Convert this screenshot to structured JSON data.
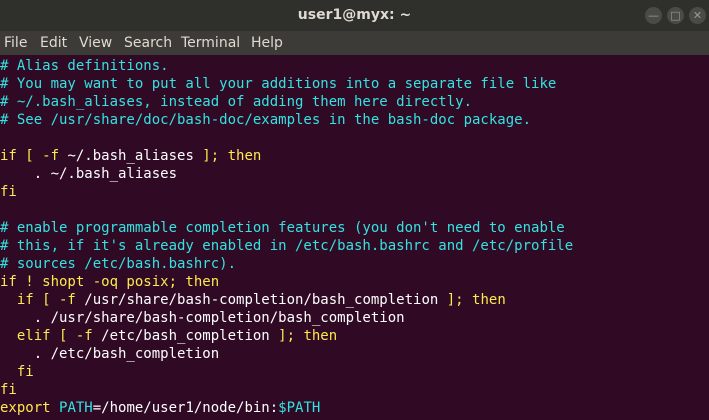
{
  "window": {
    "title": "user1@myx: ~",
    "minimize": "—",
    "maximize": "□",
    "close": "✕"
  },
  "menu": [
    "File",
    "Edit",
    "View",
    "Search",
    "Terminal",
    "Help"
  ],
  "colors": {
    "background": "#300a24",
    "comment": "#34e2e2",
    "keyword": "#fce94f",
    "text": "#ffffff"
  },
  "lines": [
    [
      {
        "t": "# Alias definitions.",
        "c": "c"
      }
    ],
    [
      {
        "t": "# You may want to put all your additions into a separate file like",
        "c": "c"
      }
    ],
    [
      {
        "t": "# ~/.bash_aliases, instead of adding them here directly.",
        "c": "c"
      }
    ],
    [
      {
        "t": "# See /usr/share/doc/bash-doc/examples in the bash-doc package.",
        "c": "c"
      }
    ],
    [],
    [
      {
        "t": "if [ -f ",
        "c": "k"
      },
      {
        "t": "~/.bash_aliases",
        "c": ""
      },
      {
        "t": " ]; then",
        "c": "k"
      }
    ],
    [
      {
        "t": "    . ~/.bash_aliases",
        "c": ""
      }
    ],
    [
      {
        "t": "fi",
        "c": "k"
      }
    ],
    [],
    [
      {
        "t": "# enable programmable completion features (you don't need to enable",
        "c": "c"
      }
    ],
    [
      {
        "t": "# this, if it's already enabled in /etc/bash.bashrc and /etc/profile",
        "c": "c"
      }
    ],
    [
      {
        "t": "# sources /etc/bash.bashrc).",
        "c": "c"
      }
    ],
    [
      {
        "t": "if ! shopt -oq posix; then",
        "c": "k"
      }
    ],
    [
      {
        "t": "  if [ -f ",
        "c": "k"
      },
      {
        "t": "/usr/share/bash-completion/bash_completion",
        "c": ""
      },
      {
        "t": " ]; then",
        "c": "k"
      }
    ],
    [
      {
        "t": "    . /usr/share/bash-completion/bash_completion",
        "c": ""
      }
    ],
    [
      {
        "t": "  elif [ -f ",
        "c": "k"
      },
      {
        "t": "/etc/bash_completion",
        "c": ""
      },
      {
        "t": " ]; then",
        "c": "k"
      }
    ],
    [
      {
        "t": "    . /etc/bash_completion",
        "c": ""
      }
    ],
    [
      {
        "t": "  fi",
        "c": "k"
      }
    ],
    [
      {
        "t": "fi",
        "c": "k"
      }
    ],
    [
      {
        "t": "export ",
        "c": "k"
      },
      {
        "t": "PATH",
        "c": "c"
      },
      {
        "t": "=/home/user1/node/bin:",
        "c": ""
      },
      {
        "t": "$PATH",
        "c": "c"
      }
    ]
  ]
}
